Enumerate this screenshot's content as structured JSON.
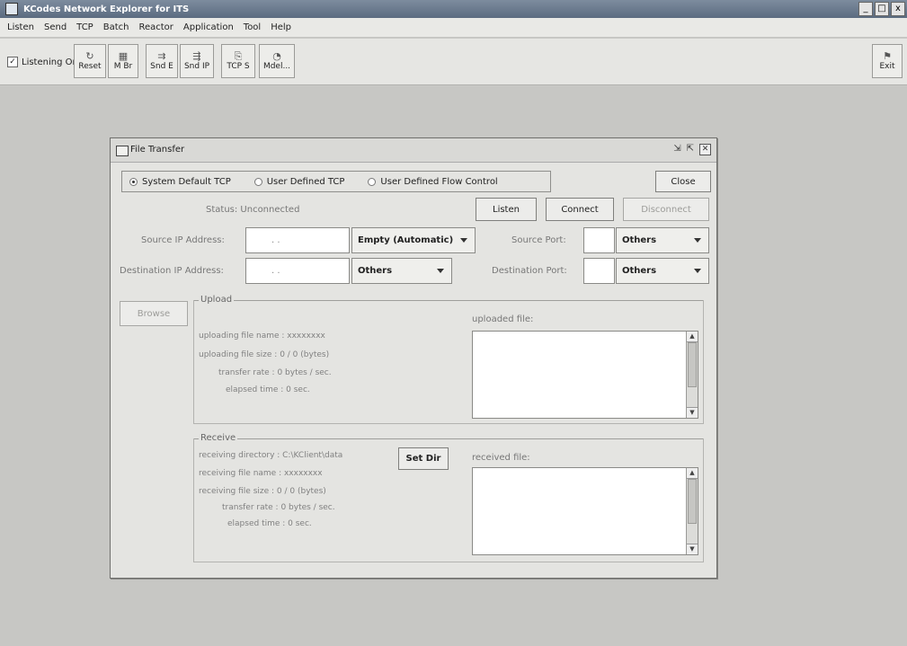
{
  "window": {
    "title": "KCodes Network Explorer for ITS",
    "minimize": "_",
    "maximize": "□",
    "close": "x"
  },
  "menu": [
    "Listen",
    "Send",
    "TCP",
    "Batch",
    "Reactor",
    "Application",
    "Tool",
    "Help"
  ],
  "toolbar": {
    "listening_label": "Listening On",
    "listening_checked": true,
    "buttons": [
      {
        "label": "Reset",
        "icon": "reset-icon"
      },
      {
        "label": "M Br",
        "icon": "broadcast-icon"
      },
      {
        "label": "Snd E",
        "icon": "send-e-icon"
      },
      {
        "label": "Snd IP",
        "icon": "send-ip-icon"
      },
      {
        "label": "TCP S",
        "icon": "tcp-server-icon"
      },
      {
        "label": "Mdel...",
        "icon": "model-icon"
      }
    ],
    "exit_label": "Exit"
  },
  "dialog": {
    "title": "File Transfer",
    "radios": [
      {
        "label": "System Default TCP",
        "selected": true
      },
      {
        "label": "User Defined TCP",
        "selected": false
      },
      {
        "label": "User Defined Flow Control",
        "selected": false
      }
    ],
    "close_label": "Close",
    "status_label": "Status: Unconnected",
    "listen_label": "Listen",
    "connect_label": "Connect",
    "disconnect_label": "Disconnect",
    "source_ip_label": "Source IP Address:",
    "source_ip_value": ". .",
    "source_ip_combo": "Empty (Automatic)",
    "source_port_label": "Source Port:",
    "source_port_combo": "Others",
    "dest_ip_label": "Destination IP Address:",
    "dest_ip_value": ". .",
    "dest_ip_combo": "Others",
    "dest_port_label": "Destination Port:",
    "dest_port_combo": "Others",
    "browse_label": "Browse",
    "upload": {
      "title": "Upload",
      "file_name": "uploading file name : xxxxxxxx",
      "file_size": "uploading file size :      0 / 0      (bytes)",
      "rate": "transfer rate :      0 bytes / sec.",
      "time": "elapsed time :      0 sec.",
      "uploaded_label": "uploaded file:"
    },
    "receive": {
      "title": "Receive",
      "directory": "receiving directory : C:\\KClient\\data",
      "set_dir_label": "Set Dir",
      "file_name": "receiving file name : xxxxxxxx",
      "file_size": "receiving file size :      0 / 0      (bytes)",
      "rate": "transfer rate :      0 bytes / sec.",
      "time": "elapsed time :      0 sec.",
      "received_label": "received file:"
    }
  }
}
